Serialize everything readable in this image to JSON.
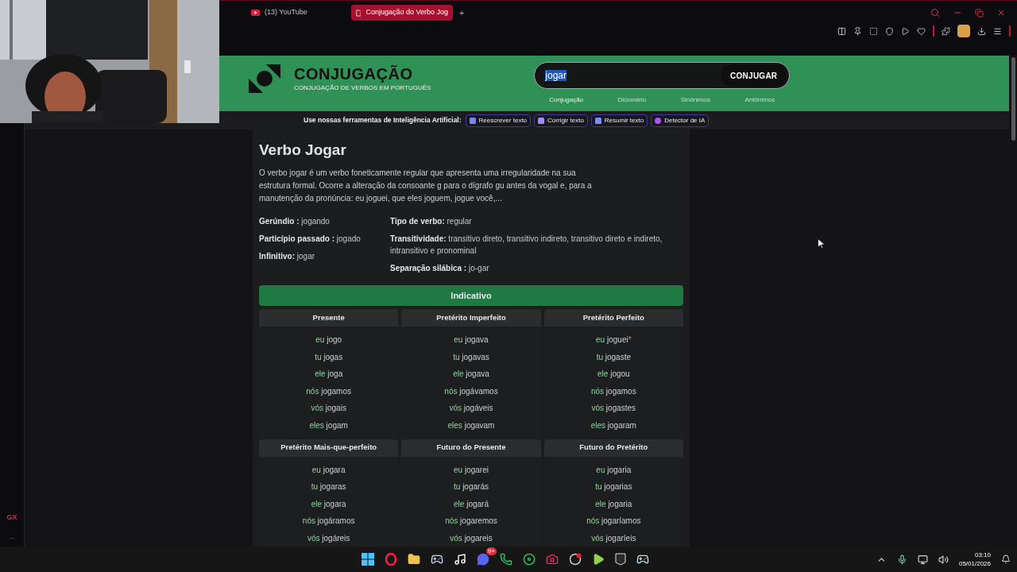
{
  "browser": {
    "tabs": [
      {
        "title": "(13) YouTube",
        "selected": false
      },
      {
        "title": "Conjugação do Verbo Jog",
        "selected": true
      }
    ],
    "new_tab": "+"
  },
  "site": {
    "title": "CONJUGAÇÃO",
    "subtitle": "CONJUGAÇÃO DE VERBOS EM PORTUGUÊS",
    "search": {
      "value": "jogar",
      "button": "CONJUGAR"
    },
    "nav": [
      {
        "label": "Conjugação",
        "selected": true
      },
      {
        "label": "Dicionário",
        "selected": false
      },
      {
        "label": "Sinônimos",
        "selected": false
      },
      {
        "label": "Antônimos",
        "selected": false
      }
    ]
  },
  "ai_tools": {
    "label": "Use nossas ferramentas de Inteligência Artificial:",
    "tools": [
      {
        "label": "Reescrever texto",
        "color": "#7c83ff"
      },
      {
        "label": "Corrigir texto",
        "color": "#a78bfa"
      },
      {
        "label": "Resumir texto",
        "color": "#818cf8"
      },
      {
        "label": "Detector de IA",
        "color": "#a855f7"
      }
    ]
  },
  "verb": {
    "title": "Verbo Jogar",
    "description": "O verbo jogar é um verbo foneticamente regular que apresenta uma irregularidade na sua estrutura formal. Ocorre a alteração da consoante g para o dígrafo gu antes da vogal e, para a manutenção da pronúncia: eu joguei, que eles joguem, jogue você,...",
    "details_left": [
      {
        "label": "Gerúndio :",
        "value": "jogando"
      },
      {
        "label": "Particípio passado :",
        "value": "jogado"
      },
      {
        "label": "Infinitivo:",
        "value": "jogar"
      }
    ],
    "details_right": [
      {
        "label": "Tipo de verbo:",
        "value": "regular"
      },
      {
        "label": "Transitividade:",
        "value": "transitivo direto, transitivo indireto, transitivo direto e indireto, intransitivo e pronominal"
      },
      {
        "label": "Separação silábica :",
        "value": "jo-gar"
      }
    ]
  },
  "mood": {
    "title": "Indicativo",
    "tenses": [
      {
        "name": "Presente",
        "forms": [
          {
            "pronoun": "eu",
            "form": "jogo"
          },
          {
            "pronoun": "tu",
            "form": "jogas"
          },
          {
            "pronoun": "ele",
            "form": "joga"
          },
          {
            "pronoun": "nós",
            "form": "jogamos"
          },
          {
            "pronoun": "vós",
            "form": "jogais"
          },
          {
            "pronoun": "eles",
            "form": "jogam"
          }
        ]
      },
      {
        "name": "Pretérito Imperfeito",
        "forms": [
          {
            "pronoun": "eu",
            "form": "jogava"
          },
          {
            "pronoun": "tu",
            "form": "jogavas"
          },
          {
            "pronoun": "ele",
            "form": "jogava"
          },
          {
            "pronoun": "nós",
            "form": "jogávamos"
          },
          {
            "pronoun": "vós",
            "form": "jogáveis"
          },
          {
            "pronoun": "eles",
            "form": "jogavam"
          }
        ]
      },
      {
        "name": "Pretérito Perfeito",
        "forms": [
          {
            "pronoun": "eu",
            "form": "joguei",
            "note": "*"
          },
          {
            "pronoun": "tu",
            "form": "jogaste"
          },
          {
            "pronoun": "ele",
            "form": "jogou"
          },
          {
            "pronoun": "nós",
            "form": "jogamos"
          },
          {
            "pronoun": "vós",
            "form": "jogastes"
          },
          {
            "pronoun": "eles",
            "form": "jogaram"
          }
        ]
      },
      {
        "name": "Pretérito Mais-que-perfeito",
        "forms": [
          {
            "pronoun": "eu",
            "form": "jogara"
          },
          {
            "pronoun": "tu",
            "form": "jogaras"
          },
          {
            "pronoun": "ele",
            "form": "jogara"
          },
          {
            "pronoun": "nós",
            "form": "jogáramos"
          },
          {
            "pronoun": "vós",
            "form": "jogáreis"
          }
        ]
      },
      {
        "name": "Futuro do Presente",
        "forms": [
          {
            "pronoun": "eu",
            "form": "jogarei"
          },
          {
            "pronoun": "tu",
            "form": "jogarás"
          },
          {
            "pronoun": "ele",
            "form": "jogará"
          },
          {
            "pronoun": "nós",
            "form": "jogaremos"
          },
          {
            "pronoun": "vós",
            "form": "jogareis"
          }
        ]
      },
      {
        "name": "Futuro do Pretérito",
        "forms": [
          {
            "pronoun": "eu",
            "form": "jogaria"
          },
          {
            "pronoun": "tu",
            "form": "jogarias"
          },
          {
            "pronoun": "ele",
            "form": "jogaria"
          },
          {
            "pronoun": "nós",
            "form": "jogaríamos"
          },
          {
            "pronoun": "vós",
            "form": "jogaríeis"
          }
        ]
      }
    ]
  },
  "opera_sidebar": {
    "badge": "GX",
    "more": "..."
  },
  "taskbar": {
    "discord_badge": "9+",
    "time": "03:10",
    "date": "05/01/2026"
  }
}
